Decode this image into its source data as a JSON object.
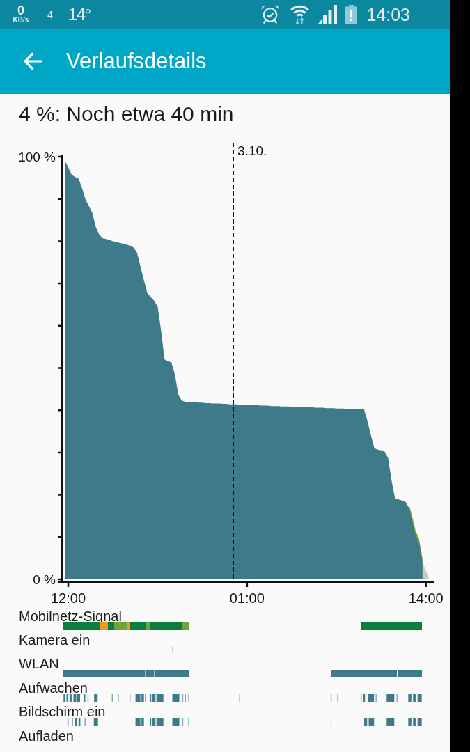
{
  "status_bar": {
    "speed": "0",
    "speed_unit": "KB/s",
    "count": "4",
    "temperature": "14°",
    "time": "14:03"
  },
  "app_bar": {
    "title": "Verlaufsdetails"
  },
  "summary": "4 %: Noch etwa 40 min",
  "chart": {
    "date_label": "3.10.",
    "chart_data": {
      "type": "area",
      "categories": [
        null,
        "12:00",
        null,
        null,
        null,
        null,
        null,
        null,
        null,
        null,
        null,
        null,
        null,
        null,
        null,
        null,
        null,
        null,
        null,
        null,
        null,
        null,
        null,
        null,
        null,
        null,
        null,
        null,
        null,
        null,
        null,
        null,
        null,
        null,
        null,
        null,
        null,
        null,
        null,
        null,
        null,
        null,
        null,
        null,
        null,
        null,
        null,
        null,
        null,
        null,
        null,
        null,
        null,
        "01:00",
        null,
        null,
        null,
        null,
        null,
        null,
        null,
        null,
        null,
        null,
        null,
        null,
        null,
        null,
        null,
        null,
        null,
        null,
        null,
        null,
        null,
        null,
        null,
        null,
        null,
        null,
        null,
        null,
        null,
        null,
        null,
        null,
        null,
        null,
        null,
        null,
        null,
        null,
        null,
        null,
        null,
        null,
        null,
        null,
        null,
        null,
        null,
        null,
        null,
        null,
        null,
        "14:00",
        null
      ],
      "series": [
        {
          "color": "#3e7a89",
          "values": [
            99.1,
            97.5,
            95.7,
            95.2,
            94.8,
            92.6,
            89.9,
            88.3,
            86.7,
            83.4,
            81.6,
            80.7,
            80.5,
            80.3,
            80.0,
            79.8,
            79.6,
            79.4,
            79.2,
            78.9,
            78.5,
            77.3,
            74.0,
            70.8,
            67.7,
            66.8,
            65.9,
            64.5,
            58.8,
            52.0,
            51.6,
            51.3,
            48.5,
            43.7,
            42.3,
            42.0,
            41.9,
            41.9,
            41.9,
            41.8,
            41.8,
            41.7,
            41.7,
            41.6,
            41.6,
            41.6,
            41.5,
            41.5,
            41.4,
            41.4,
            41.4,
            41.3,
            41.3,
            41.3,
            41.2,
            41.2,
            41.2,
            41.1,
            41.1,
            41.1,
            41.0,
            41.0,
            41.0,
            40.9,
            40.9,
            40.9,
            40.8,
            40.8,
            40.8,
            40.8,
            40.7,
            40.7,
            40.7,
            40.6,
            40.6,
            40.6,
            40.5,
            40.5,
            40.5,
            40.4,
            40.4,
            40.4,
            40.3,
            40.3,
            40.3,
            40.3,
            40.2,
            40.2,
            37.5,
            34.1,
            31.0,
            30.7,
            30.5,
            30.2,
            28.7,
            23.4,
            19.2,
            18.9,
            18.7,
            18.4,
            17.0,
            13.9,
            10.5,
            8.6,
            4,
            null,
            null
          ]
        },
        {
          "color": "#c9c9c9",
          "values": [
            null,
            null,
            null,
            null,
            null,
            null,
            null,
            null,
            null,
            null,
            null,
            null,
            null,
            null,
            null,
            null,
            null,
            null,
            null,
            null,
            null,
            null,
            null,
            null,
            null,
            null,
            null,
            null,
            null,
            null,
            null,
            null,
            null,
            null,
            null,
            null,
            null,
            null,
            null,
            null,
            null,
            null,
            null,
            null,
            null,
            null,
            null,
            null,
            null,
            null,
            null,
            null,
            null,
            null,
            null,
            null,
            null,
            null,
            null,
            null,
            null,
            null,
            null,
            null,
            null,
            null,
            null,
            null,
            null,
            null,
            null,
            null,
            null,
            null,
            null,
            null,
            null,
            null,
            null,
            null,
            null,
            null,
            null,
            null,
            null,
            null,
            null,
            null,
            null,
            null,
            null,
            null,
            null,
            null,
            null,
            null,
            null,
            null,
            null,
            null,
            null,
            null,
            null,
            null,
            4,
            2,
            0
          ]
        },
        {
          "color": "#8a9a3c",
          "values": [
            null,
            null,
            null,
            null,
            null,
            null,
            null,
            null,
            null,
            null,
            null,
            null,
            null,
            null,
            null,
            null,
            null,
            null,
            null,
            null,
            null,
            null,
            null,
            null,
            null,
            null,
            null,
            null,
            null,
            null,
            null,
            null,
            null,
            null,
            null,
            null,
            null,
            null,
            null,
            null,
            null,
            null,
            null,
            null,
            null,
            null,
            null,
            null,
            null,
            null,
            null,
            null,
            null,
            null,
            null,
            null,
            null,
            null,
            null,
            null,
            null,
            null,
            null,
            null,
            null,
            null,
            null,
            null,
            null,
            null,
            null,
            null,
            null,
            null,
            null,
            null,
            null,
            null,
            null,
            null,
            null,
            null,
            null,
            null,
            null,
            null,
            null,
            null,
            null,
            null,
            null,
            null,
            null,
            null,
            null,
            null,
            null,
            null,
            null,
            null,
            18.0,
            14.9,
            11.5,
            9.6,
            5.0,
            null,
            null
          ]
        }
      ],
      "ylim": [
        0,
        100
      ],
      "yticks": [
        {
          "value": 0,
          "label": "0 %"
        },
        {
          "value": 100,
          "label": "100 %"
        }
      ]
    }
  },
  "tracks": [
    {
      "label": "Mobilnetz-Signal"
    },
    {
      "label": "Kamera ein"
    },
    {
      "label": "WLAN"
    },
    {
      "label": "Aufwachen"
    },
    {
      "label": "Bildschirm ein"
    },
    {
      "label": "Aufladen"
    }
  ]
}
